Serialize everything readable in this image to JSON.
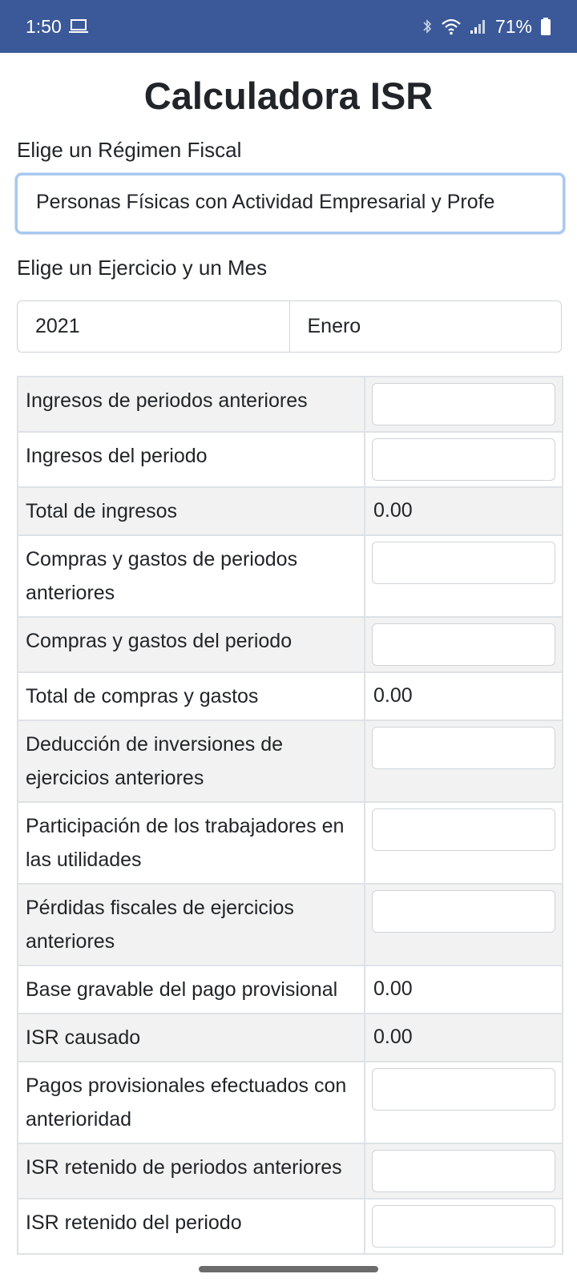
{
  "status_bar": {
    "time": "1:50",
    "battery": "71%",
    "icons": [
      "laptop-icon",
      "bluetooth-icon",
      "wifi-icon",
      "signal-icon",
      "battery-icon"
    ]
  },
  "title": "Calculadora ISR",
  "regimen": {
    "label": "Elige un Régimen Fiscal",
    "selected": "Personas Físicas con Actividad Empresarial y Profe"
  },
  "period": {
    "label": "Elige un Ejercicio y un Mes",
    "year": "2021",
    "month": "Enero"
  },
  "rows": [
    {
      "label": "Ingresos de periodos anteriores",
      "type": "input",
      "value": ""
    },
    {
      "label": "Ingresos del periodo",
      "type": "input",
      "value": ""
    },
    {
      "label": "Total de ingresos",
      "type": "value",
      "value": "0.00"
    },
    {
      "label": "Compras y gastos de periodos anteriores",
      "type": "input",
      "value": ""
    },
    {
      "label": "Compras y gastos del periodo",
      "type": "input",
      "value": ""
    },
    {
      "label": "Total de compras y gastos",
      "type": "value",
      "value": "0.00"
    },
    {
      "label": "Deducción de inversiones de ejercicios anteriores",
      "type": "input",
      "value": ""
    },
    {
      "label": "Participación de los trabajadores en las utilidades",
      "type": "input",
      "value": ""
    },
    {
      "label": "Pérdidas fiscales de ejercicios anteriores",
      "type": "input",
      "value": ""
    },
    {
      "label": "Base gravable del pago provisional",
      "type": "value",
      "value": "0.00"
    },
    {
      "label": "ISR causado",
      "type": "value",
      "value": "0.00"
    },
    {
      "label": "Pagos provisionales efectuados con anterioridad",
      "type": "input",
      "value": ""
    },
    {
      "label": "ISR retenido de periodos anteriores",
      "type": "input",
      "value": ""
    },
    {
      "label": "ISR retenido del periodo",
      "type": "input",
      "value": ""
    }
  ]
}
